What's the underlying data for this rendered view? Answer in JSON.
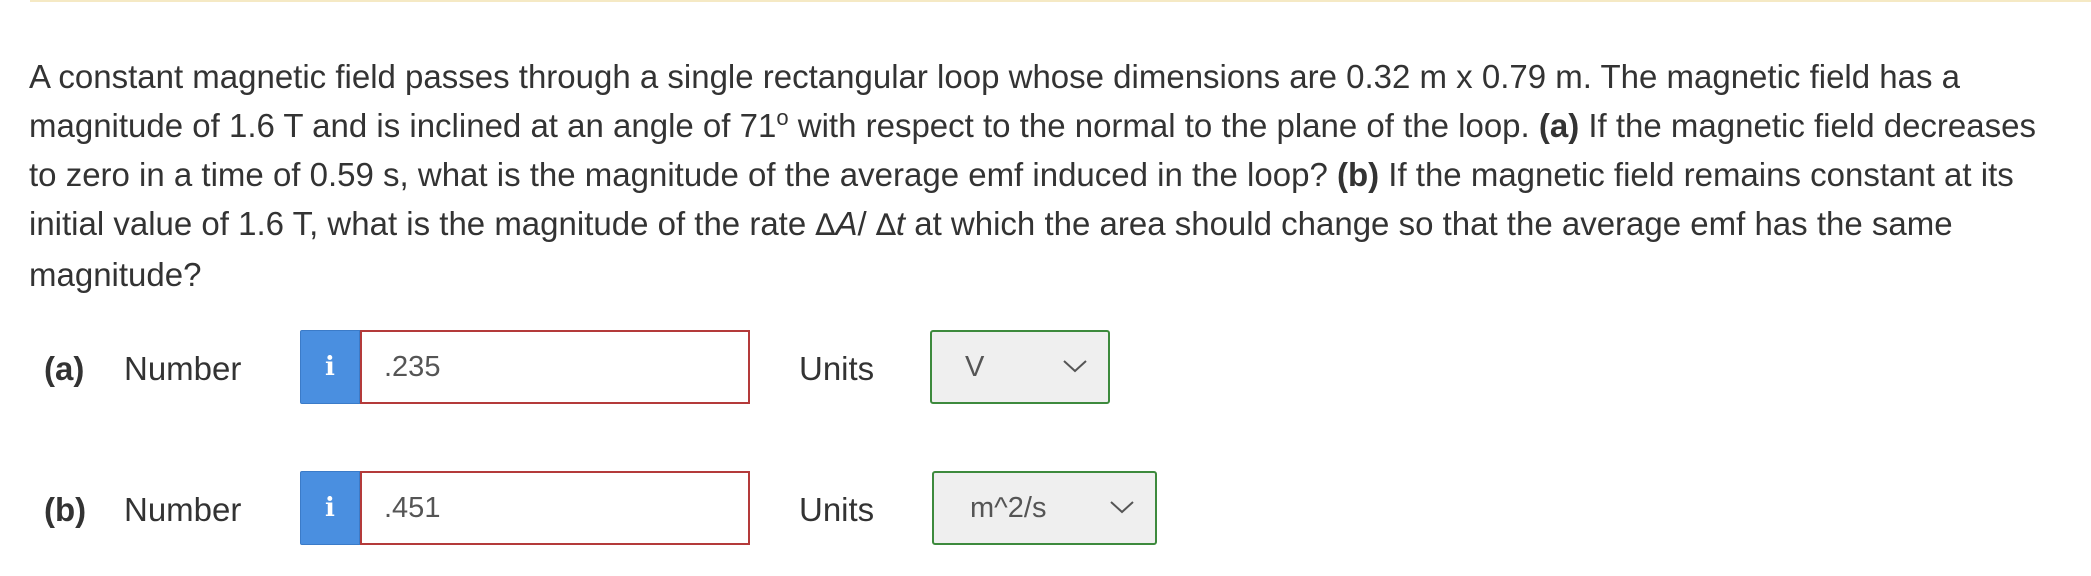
{
  "question": {
    "t1": "A constant magnetic field passes through a single rectangular loop whose dimensions are 0.32 m x 0.79 m. The magnetic field has a magnitude of 1.6 T and is inclined at an angle of 71",
    "degree": "o",
    "t2": " with respect to the normal to the plane of the loop. ",
    "part_a_tag": "(a)",
    "t3": " If the magnetic field decreases to zero in a time of 0.59 s, what is the magnitude of the average emf induced in the loop? ",
    "part_b_tag": "(b)",
    "t4": " If the magnetic field remains constant at its initial value of 1.6 T, what is the magnitude of the rate ",
    "delta1": "∆",
    "var_a": "A",
    "slash": "/ ",
    "delta2": "∆",
    "var_t": "t",
    "t5": " at which the area should change so that the average emf has the same magnitude?"
  },
  "answers": [
    {
      "part_label": "(a)",
      "number_label": "Number",
      "info_icon": "i",
      "value": ".235",
      "units_label": "Units",
      "units_value": "V"
    },
    {
      "part_label": "(b)",
      "number_label": "Number",
      "info_icon": "i",
      "value": ".451",
      "units_label": "Units",
      "units_value": "m^2/s"
    }
  ],
  "icons": {
    "info": "info-icon",
    "dropdown": "chevron-down-icon"
  },
  "colors": {
    "info_button": "#4a8fe0",
    "input_border_incorrect": "#b43a3a",
    "select_border_correct": "#3d8a3d",
    "select_background": "#efefef",
    "top_rule": "#f5e9c4"
  }
}
